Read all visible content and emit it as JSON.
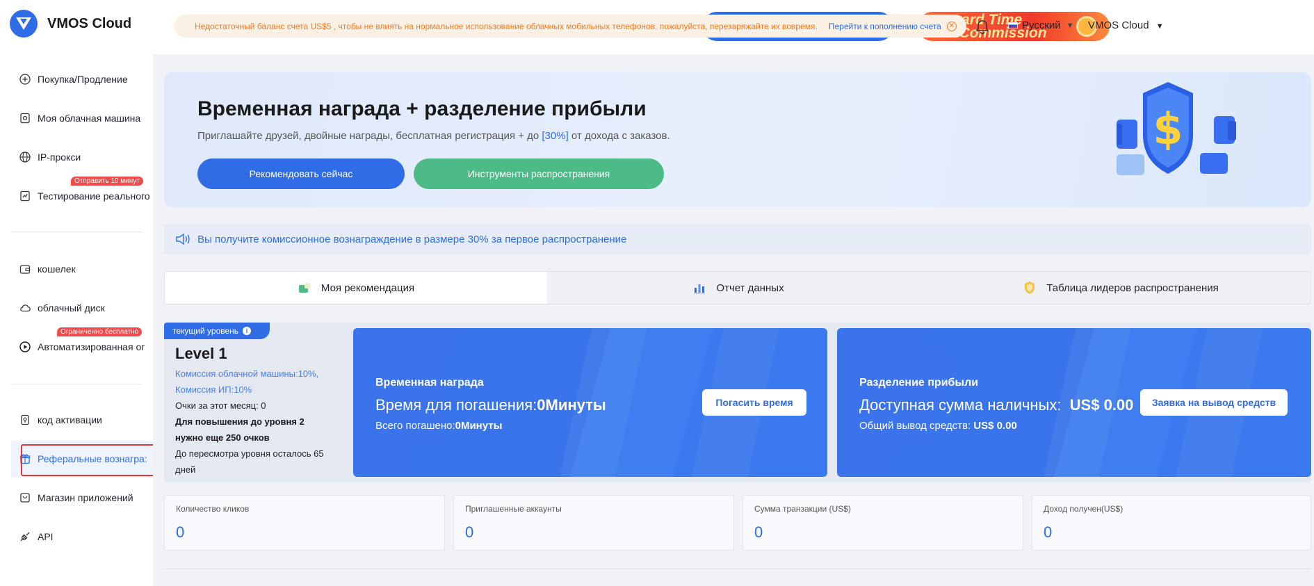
{
  "app": {
    "name": "VMOS Cloud",
    "brand_color": "#2f6ce5"
  },
  "sidebar": {
    "items": [
      {
        "label": "Покупка/Продление",
        "icon": "plus-circle-icon"
      },
      {
        "label": "Моя облачная машина",
        "icon": "cloud-phone-icon"
      },
      {
        "label": "IP-прокси",
        "icon": "globe-icon"
      },
      {
        "label": "Тестирование реального",
        "icon": "test-icon",
        "badge": "Отправить 10 минут"
      },
      {
        "label": "кошелек",
        "icon": "wallet-icon"
      },
      {
        "label": "облачный диск",
        "icon": "cloud-icon"
      },
      {
        "label": "Автоматизированная ог",
        "icon": "play-circle-icon",
        "badge": "Ограниченно бесплатно"
      },
      {
        "label": "код активации",
        "icon": "key-icon"
      },
      {
        "label": "Реферальные вознагра:",
        "icon": "gift-icon",
        "active": true
      },
      {
        "label": "Магазин приложений",
        "icon": "store-icon"
      },
      {
        "label": "API",
        "icon": "api-icon"
      }
    ]
  },
  "topbar": {
    "notice_text": "Недостаточный баланс счета US$5 , чтобы не влиять на нормальное использование облачных мобильных телефонов, пожалуйста, перезаряжайте их вовремя.",
    "notice_link": "Перейти к пополнению счета",
    "promo_line1": "eward Time",
    "promo_line2": "% Commission",
    "language": "Русский",
    "account": "VMOS Cloud"
  },
  "banner": {
    "title": "Временная награда + разделение прибыли",
    "subtitle_before": "Приглашайте друзей, двойные награды, бесплатная регистрация + до ",
    "subtitle_pct": "[30%]",
    "subtitle_after": " от дохода с заказов.",
    "btn_recommend": "Рекомендовать сейчас",
    "btn_tools": "Инструменты распространения"
  },
  "strip": {
    "text": "Вы получите комиссионное вознаграждение в размере 30% за первое распространение"
  },
  "tabs": [
    {
      "label": "Моя рекомендация",
      "icon": "recommend-icon",
      "active": true
    },
    {
      "label": "Отчет данных",
      "icon": "report-chart-icon"
    },
    {
      "label": "Таблица лидеров распространения",
      "icon": "trophy-shield-icon"
    }
  ],
  "level": {
    "tag": "текущий уровень",
    "title": "Level 1",
    "commission_machine": "Комиссия облачной машины:10%,",
    "commission_ip": "Комиссия ИП:10%",
    "points_month": "Очки за этот месяц: 0",
    "upgrade_line1": "Для повышения до уровня 2",
    "upgrade_line2": "нужно еще 250 очков",
    "review_line1": "До пересмотра уровня осталось 65",
    "review_line2": "дней"
  },
  "time_card": {
    "title": "Временная награда",
    "main_label": "Время для погашения:",
    "main_value": "0Минуты",
    "sub_label": "Всего погашено:",
    "sub_value": "0Минуты",
    "button": "Погасить время"
  },
  "profit_card": {
    "title": "Разделение прибыли",
    "main_label": "Доступная сумма наличных:",
    "main_value": "US$ 0.00",
    "sub_label": "Общий вывод средств: ",
    "sub_value": "US$ 0.00",
    "button": "Заявка на вывод средств"
  },
  "stats": [
    {
      "label": "Количество кликов",
      "value": "0"
    },
    {
      "label": "Приглашенные аккаунты",
      "value": "0"
    },
    {
      "label": "Сумма транзакции (US$)",
      "value": "0"
    },
    {
      "label": "Доход получен(US$)",
      "value": "0"
    }
  ]
}
